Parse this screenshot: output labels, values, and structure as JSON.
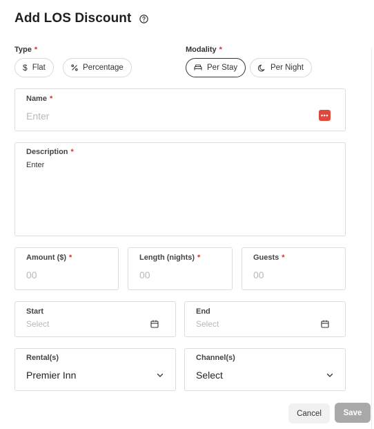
{
  "dialog": {
    "title": "Add LOS Discount"
  },
  "type_group": {
    "label": "Type",
    "required_mark": "*",
    "options": [
      {
        "label": "Flat",
        "icon": "dollar-icon",
        "selected": false
      },
      {
        "label": "Percentage",
        "icon": "percent-icon",
        "selected": false
      }
    ]
  },
  "modality_group": {
    "label": "Modality",
    "required_mark": "*",
    "options": [
      {
        "label": "Per Stay",
        "icon": "bed-icon",
        "selected": true
      },
      {
        "label": "Per Night",
        "icon": "moon-icon",
        "selected": false
      }
    ]
  },
  "fields": {
    "name": {
      "label": "Name",
      "required_mark": "*",
      "placeholder": "Enter",
      "badge": "•••"
    },
    "description": {
      "label": "Description",
      "required_mark": "*",
      "placeholder": "Enter"
    },
    "amount": {
      "label": "Amount ($)",
      "required_mark": "*",
      "placeholder": "00"
    },
    "length": {
      "label": "Length (nights)",
      "required_mark": "*",
      "placeholder": "00"
    },
    "guests": {
      "label": "Guests",
      "required_mark": "*",
      "placeholder": "00"
    },
    "start": {
      "label": "Start",
      "placeholder": "Select"
    },
    "end": {
      "label": "End",
      "placeholder": "Select"
    },
    "rentals": {
      "label": "Rental(s)",
      "value": "Premier Inn"
    },
    "channels": {
      "label": "Channel(s)",
      "value": "Select"
    }
  },
  "footer": {
    "cancel_label": "Cancel",
    "save_label": "Save"
  },
  "colors": {
    "required": "#d93025",
    "badge": "#e0483e",
    "save_disabled": "#a9a9a9"
  }
}
